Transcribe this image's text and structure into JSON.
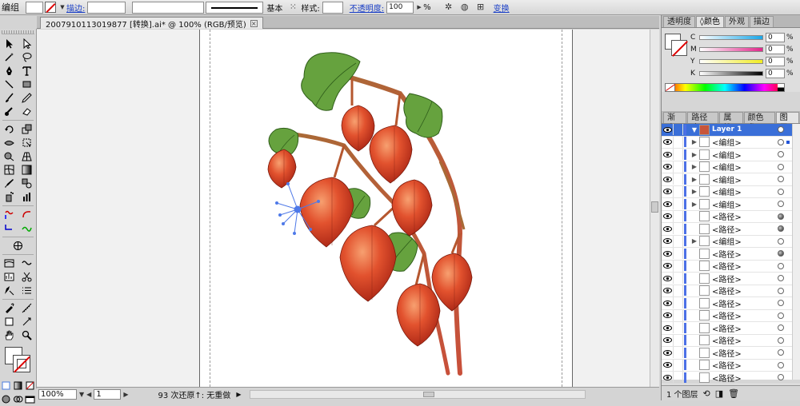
{
  "control_bar": {
    "selection_label": "编组",
    "stroke_label": "描边:",
    "stroke_style": "基本",
    "style_label": "样式:",
    "opacity_label": "不透明度:",
    "opacity_value": "100",
    "opacity_unit": "%",
    "transform_label": "变换"
  },
  "document_tab": {
    "title": "2007910113019877 [转换].ai* @ 100% (RGB/预览)"
  },
  "status_bar": {
    "zoom": "100%",
    "page": "1",
    "message": "93 次还原↑: 无重做"
  },
  "color_panel": {
    "tabs": [
      "透明度",
      "◊颜色",
      "外观",
      "描边"
    ],
    "channels": [
      {
        "label": "C",
        "value": "0",
        "color": "#1aa7e8"
      },
      {
        "label": "M",
        "value": "0",
        "color": "#e0268a"
      },
      {
        "label": "Y",
        "value": "0",
        "color": "#f1ec22"
      },
      {
        "label": "K",
        "value": "0",
        "color": "#000000"
      }
    ],
    "unit": "%"
  },
  "layers_panel": {
    "tabs": [
      "渐变",
      "路径查",
      "属性",
      "颜色参",
      "图层"
    ],
    "top_layer": "Layer 1",
    "items": [
      {
        "name": "<编组>",
        "twisty": "▶",
        "target": "empty"
      },
      {
        "name": "<编组>",
        "twisty": "▶",
        "target": "empty"
      },
      {
        "name": "<编组>",
        "twisty": "▶",
        "target": "empty"
      },
      {
        "name": "<编组>",
        "twisty": "▶",
        "target": "empty"
      },
      {
        "name": "<编组>",
        "twisty": "▶",
        "target": "empty"
      },
      {
        "name": "<编组>",
        "twisty": "▶",
        "target": "empty"
      },
      {
        "name": "<路径>",
        "twisty": "",
        "target": "filled"
      },
      {
        "name": "<路径>",
        "twisty": "",
        "target": "filled"
      },
      {
        "name": "<编组>",
        "twisty": "▶",
        "target": "empty"
      },
      {
        "name": "<路径>",
        "twisty": "",
        "target": "filled"
      },
      {
        "name": "<路径>",
        "twisty": "",
        "target": "empty"
      },
      {
        "name": "<路径>",
        "twisty": "",
        "target": "empty"
      },
      {
        "name": "<路径>",
        "twisty": "",
        "target": "empty"
      },
      {
        "name": "<路径>",
        "twisty": "",
        "target": "empty"
      },
      {
        "name": "<路径>",
        "twisty": "",
        "target": "empty"
      },
      {
        "name": "<路径>",
        "twisty": "",
        "target": "empty"
      },
      {
        "name": "<路径>",
        "twisty": "",
        "target": "empty"
      },
      {
        "name": "<路径>",
        "twisty": "",
        "target": "empty"
      },
      {
        "name": "<路径>",
        "twisty": "",
        "target": "empty"
      },
      {
        "name": "<路径>",
        "twisty": "",
        "target": "empty"
      }
    ],
    "footer": "1 个图层"
  },
  "colors": {
    "accent": "#3a6fd8",
    "layer_color": "#4c70e6",
    "lantern": "#d8442a",
    "leaf": "#5a9a36"
  }
}
